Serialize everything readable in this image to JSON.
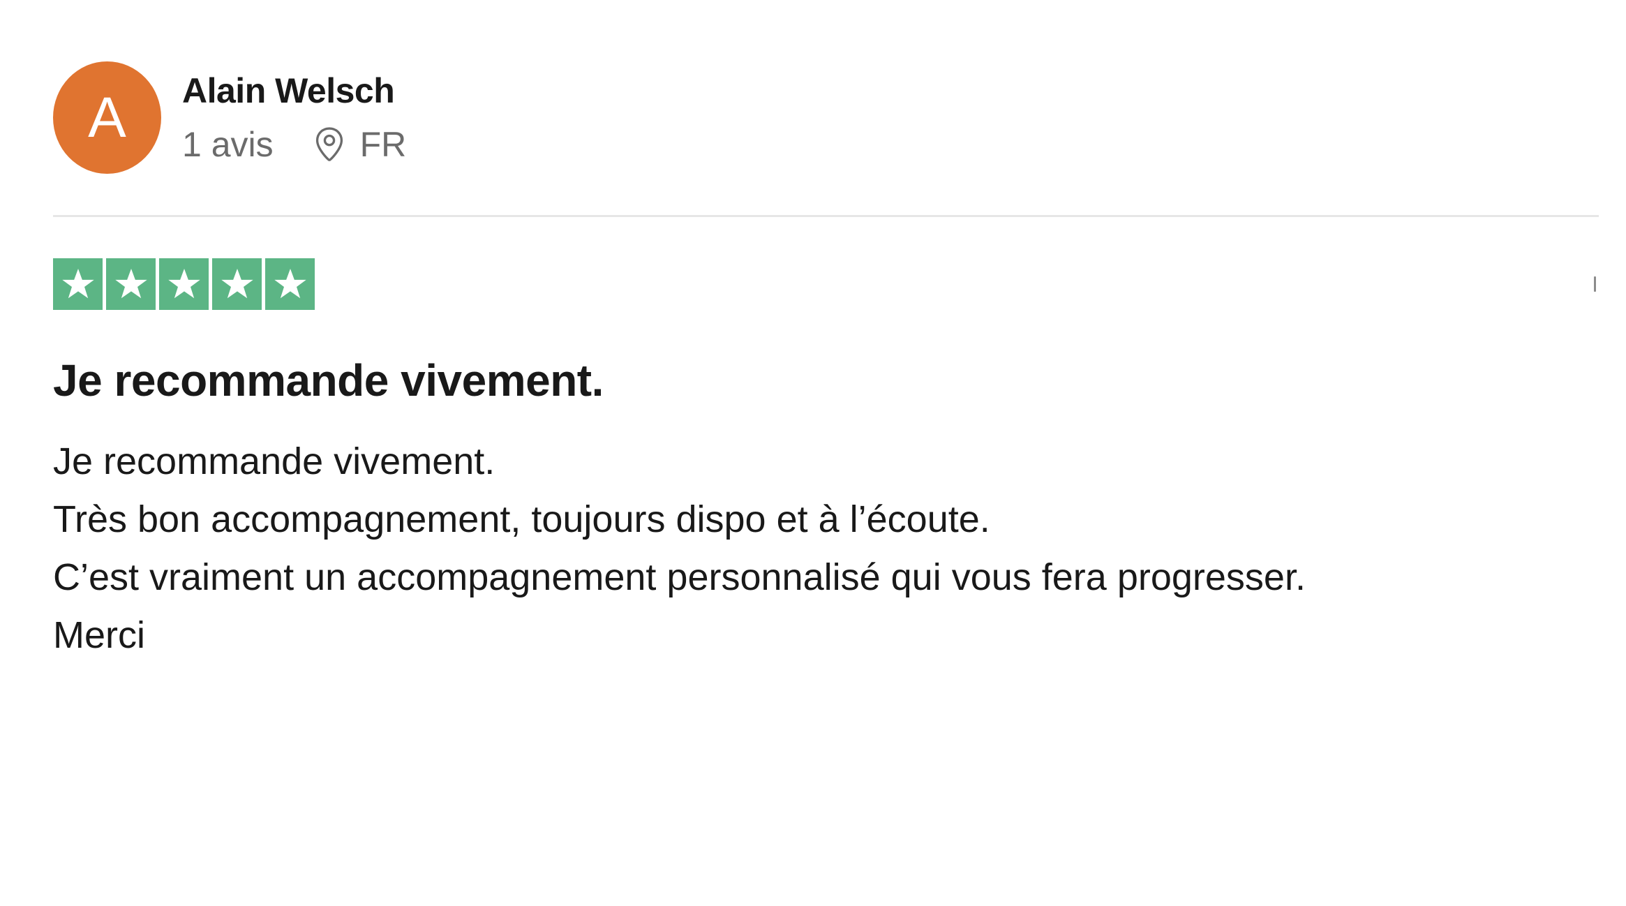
{
  "consumer": {
    "avatar_initial": "A",
    "avatar_color": "#e07430",
    "name": "Alain Welsch",
    "review_count": "1 avis",
    "country": "FR"
  },
  "rating": {
    "stars": 5,
    "max": 5,
    "star_color": "#5cb585"
  },
  "review": {
    "title": "Je recommande vivement.",
    "lines": [
      "Je recommande vivement.",
      "Très bon accompagnement, toujours dispo et à l’écoute.",
      "C’est vraiment un accompagnement personnalisé qui vous fera progresser.",
      "Merci"
    ]
  },
  "icons": {
    "location": "location-pin-icon",
    "star": "star-icon"
  }
}
